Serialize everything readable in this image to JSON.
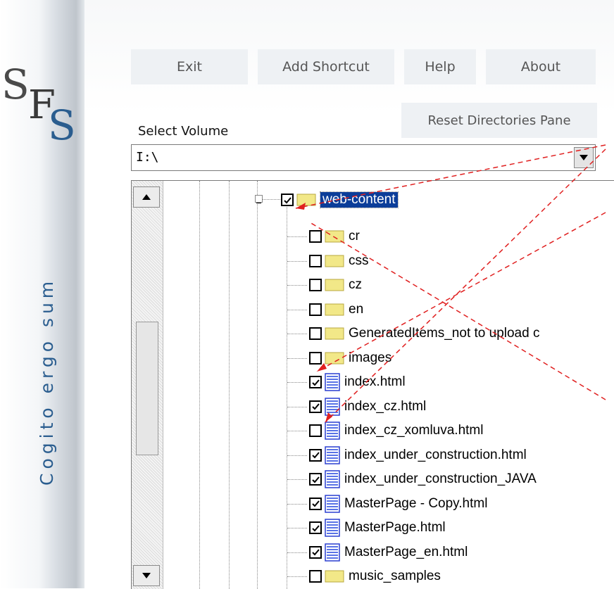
{
  "logo": {
    "letters": "SFS"
  },
  "tagline": "Cogito ergo sum",
  "toolbar": {
    "exit_label": "Exit",
    "add_shortcut_label": "Add Shortcut",
    "help_label": "Help",
    "about_label": "About",
    "reset_label": "Reset Directories Pane"
  },
  "volume": {
    "label": "Select Volume",
    "value": "I:\\"
  },
  "tree": {
    "root": {
      "label": "web-content",
      "checked": true,
      "type": "folder"
    },
    "items": [
      {
        "label": "cr",
        "checked": false,
        "type": "folder"
      },
      {
        "label": "css",
        "checked": false,
        "type": "folder"
      },
      {
        "label": "cz",
        "checked": false,
        "type": "folder"
      },
      {
        "label": "en",
        "checked": false,
        "type": "folder"
      },
      {
        "label": "GeneratedItems_not to upload c",
        "checked": false,
        "type": "folder"
      },
      {
        "label": "images",
        "checked": false,
        "type": "folder"
      },
      {
        "label": "index.html",
        "checked": true,
        "type": "file"
      },
      {
        "label": "index_cz.html",
        "checked": true,
        "type": "file"
      },
      {
        "label": "index_cz_xomluva.html",
        "checked": false,
        "type": "file"
      },
      {
        "label": "index_under_construction.html",
        "checked": true,
        "type": "file"
      },
      {
        "label": "index_under_construction_JAVA",
        "checked": true,
        "type": "file"
      },
      {
        "label": "MasterPage - Copy.html",
        "checked": true,
        "type": "file"
      },
      {
        "label": "MasterPage.html",
        "checked": true,
        "type": "file"
      },
      {
        "label": "MasterPage_en.html",
        "checked": true,
        "type": "file"
      },
      {
        "label": "music_samples",
        "checked": false,
        "type": "folder"
      }
    ]
  },
  "colors": {
    "accent": "#2a5d8f",
    "selection": "#0b3d99",
    "annotation": "#e02020"
  }
}
